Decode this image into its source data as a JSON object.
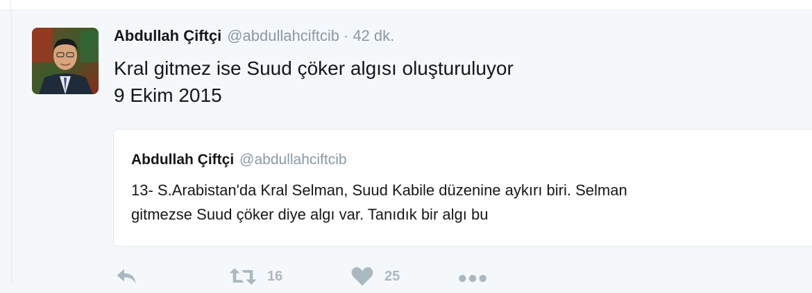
{
  "tweet": {
    "fullname": "Abdullah Çiftçi",
    "username": "@abdullahciftcib",
    "separator": "·",
    "time": "42 dk.",
    "text_lines": [
      "Kral gitmez ise Suud çöker algısı oluşturuluyor",
      "9 Ekim 2015"
    ]
  },
  "quote": {
    "fullname": "Abdullah Çiftçi",
    "username": "@abdullahciftcib",
    "text_lines": [
      "13- S.Arabistan'da Kral Selman, Suud Kabile düzenine aykırı biri. Selman",
      "gitmezse Suud çöker diye algı var. Tanıdık bir algı bu"
    ]
  },
  "actions": {
    "reply_icon": "reply-icon",
    "retweet_icon": "retweet-icon",
    "retweet_count": "16",
    "like_icon": "heart-icon",
    "like_count": "25",
    "more_icon": "more-dots-icon"
  },
  "colors": {
    "background": "#f5f8fa",
    "text": "#14171a",
    "secondary_text": "#8899a6",
    "action_icon": "#aab8c2",
    "border": "#e1e8ed"
  }
}
